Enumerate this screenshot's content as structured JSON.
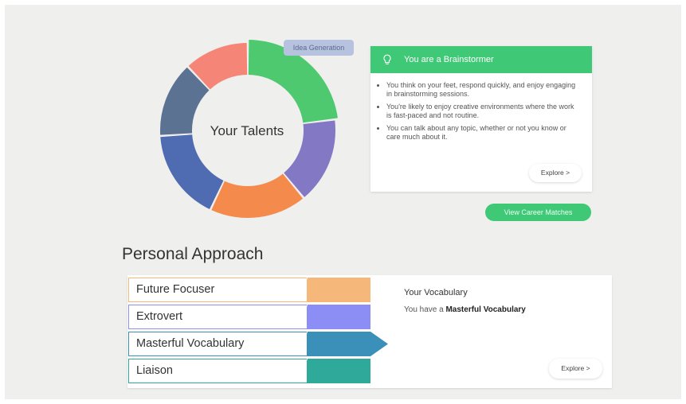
{
  "donut": {
    "center_label": "Your Talents",
    "hover_tag": "Idea Generation",
    "segments": [
      {
        "name": "idea-generation",
        "fraction": 0.23,
        "color": "#4ec970"
      },
      {
        "name": "segment-purple",
        "fraction": 0.16,
        "color": "#8278c4"
      },
      {
        "name": "segment-orange",
        "fraction": 0.18,
        "color": "#f48a4b"
      },
      {
        "name": "segment-blue",
        "fraction": 0.17,
        "color": "#4f6cb2"
      },
      {
        "name": "segment-slate",
        "fraction": 0.14,
        "color": "#5c7293"
      },
      {
        "name": "segment-salmon",
        "fraction": 0.12,
        "color": "#f58577"
      }
    ]
  },
  "talent_card": {
    "title": "You are a Brainstormer",
    "accent": "#3fc977",
    "bullets": [
      "You think on your feet, respond quickly, and enjoy engaging in brainstorming sessions.",
      "You're likely to enjoy creative environments where the work is fast-paced and not routine.",
      "You can talk about any topic, whether or not you know or care much about it."
    ],
    "explore_label": "Explore >"
  },
  "career_button": "View Career Matches",
  "personal_approach": {
    "title": "Personal Approach",
    "items": [
      {
        "label": "Future Focuser",
        "color": "#f6b77a"
      },
      {
        "label": "Extrovert",
        "color": "#8c8ef6"
      },
      {
        "label": "Masterful Vocabulary",
        "color": "#3a90b8"
      },
      {
        "label": "Liaison",
        "color": "#2fa99a"
      }
    ],
    "selected_index": 2,
    "detail": {
      "title": "Your Vocabulary",
      "text_prefix": "You have a",
      "text_bold": "Masterful Vocabulary",
      "explore_label": "Explore >"
    }
  }
}
